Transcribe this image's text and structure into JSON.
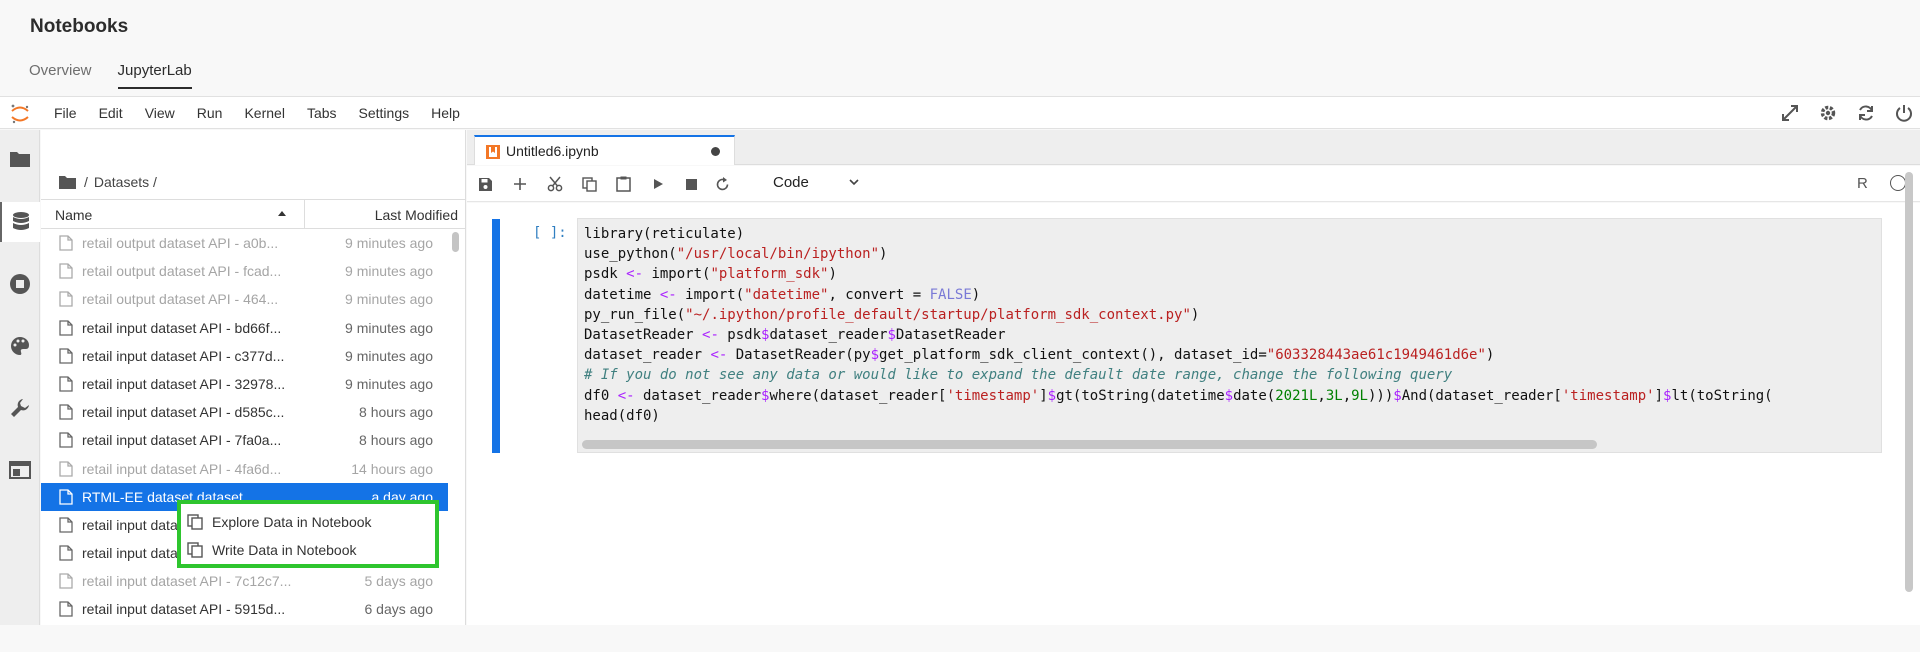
{
  "app": {
    "title": "Notebooks",
    "tabs": [
      {
        "label": "Overview"
      },
      {
        "label": "JupyterLab"
      }
    ]
  },
  "menu": {
    "items": [
      "File",
      "Edit",
      "View",
      "Run",
      "Kernel",
      "Tabs",
      "Settings",
      "Help"
    ]
  },
  "filebrowser": {
    "breadcrumb_sep": "/",
    "breadcrumb_path": "Datasets /",
    "header": {
      "name": "Name",
      "modified": "Last Modified"
    },
    "rows": [
      {
        "name": "retail output dataset API - a0b...",
        "modified": "9 minutes ago",
        "dim": true
      },
      {
        "name": "retail output dataset API - fcad...",
        "modified": "9 minutes ago",
        "dim": true
      },
      {
        "name": "retail output dataset API - 464...",
        "modified": "9 minutes ago",
        "dim": true
      },
      {
        "name": "retail input dataset API - bd66f...",
        "modified": "9 minutes ago",
        "dim": false
      },
      {
        "name": "retail input dataset API - c377d...",
        "modified": "9 minutes ago",
        "dim": false
      },
      {
        "name": "retail input dataset API - 32978...",
        "modified": "9 minutes ago",
        "dim": false
      },
      {
        "name": "retail input dataset API - d585c...",
        "modified": "8 hours ago",
        "dim": false
      },
      {
        "name": "retail input dataset API - 7fa0a...",
        "modified": "8 hours ago",
        "dim": false
      },
      {
        "name": "retail input dataset API - 4fa6d...",
        "modified": "14 hours ago",
        "dim": true
      },
      {
        "name": "RTML-EE dataset dataset",
        "modified": "a day ago",
        "dim": false,
        "selected": true
      },
      {
        "name": "retail input data",
        "modified": "",
        "dim": false
      },
      {
        "name": "retail input data",
        "modified": "",
        "dim": false
      },
      {
        "name": "retail input dataset API - 7c12c7...",
        "modified": "5 days ago",
        "dim": true
      },
      {
        "name": "retail input dataset API - 5915d...",
        "modified": "6 days ago",
        "dim": false
      }
    ]
  },
  "context_menu": {
    "items": [
      {
        "label": "Explore Data in Notebook"
      },
      {
        "label": "Write Data in Notebook"
      }
    ]
  },
  "notebook": {
    "tab_label": "Untitled6.ipynb",
    "cell_type": "Code",
    "kernel": "R",
    "prompt": "[ ]:",
    "code_lines": [
      "library(reticulate)",
      "use_python(\"/usr/local/bin/ipython\")",
      "psdk <- import(\"platform_sdk\")",
      "datetime <- import(\"datetime\", convert = FALSE)",
      "py_run_file(\"~/.ipython/profile_default/startup/platform_sdk_context.py\")",
      "DatasetReader <- psdk$dataset_reader$DatasetReader",
      "dataset_reader <- DatasetReader(py$get_platform_sdk_client_context(), dataset_id=\"603328443ae61c1949461d6e\")",
      "# If you do not see any data or would like to expand the default date range, change the following query",
      "df0 <- dataset_reader$where(dataset_reader['timestamp']$gt(toString(datetime$date(2021L,3L,9L)))$And(dataset_reader['timestamp']$lt(toString(",
      "head(df0)"
    ]
  },
  "colors": {
    "accent": "#1473e6",
    "highlight_border": "#2ec52e",
    "logo": "#f37726"
  },
  "icons": [
    "jupyter-logo-icon",
    "expand-icon",
    "gear-icon",
    "refresh-icon",
    "power-icon",
    "folder-icon",
    "database-icon",
    "stop-circle-icon",
    "palette-icon",
    "wrench-icon",
    "tab-window-icon",
    "file-icon",
    "copy-icon",
    "save-icon",
    "plus-icon",
    "cut-icon",
    "paste-icon",
    "run-icon",
    "stop-icon",
    "restart-icon",
    "chevron-down-icon",
    "sort-up-icon",
    "notebook-icon"
  ]
}
